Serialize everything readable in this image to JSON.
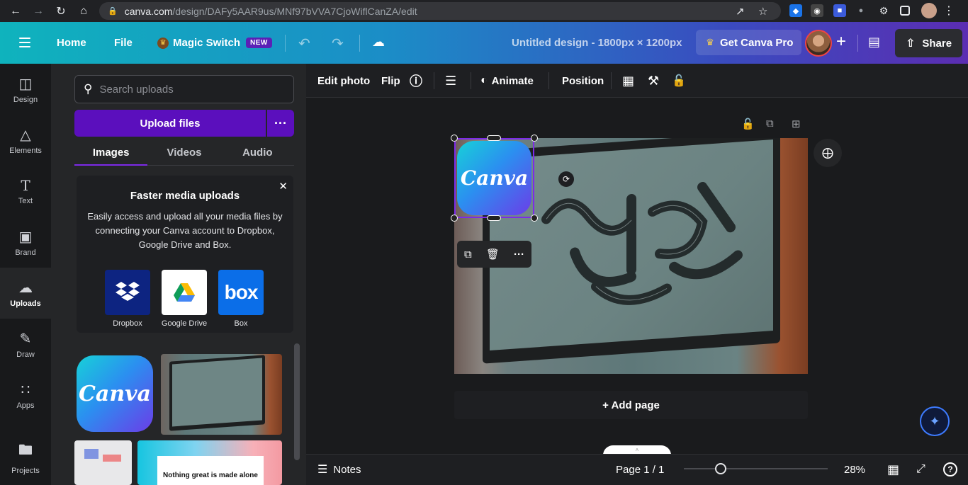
{
  "browser": {
    "url_host": "canva.com",
    "url_path": "/design/DAFy5AAR9us/MNf97bVVA7CjoWiflCanZA/edit"
  },
  "header": {
    "home": "Home",
    "file": "File",
    "magic_switch": "Magic Switch",
    "new_badge": "NEW",
    "design_title": "Untitled design - 1800px × 1200px",
    "get_pro": "Get Canva Pro",
    "share": "Share"
  },
  "rail": {
    "items": [
      {
        "label": "Design",
        "icon": "design-icon"
      },
      {
        "label": "Elements",
        "icon": "elements-icon"
      },
      {
        "label": "Text",
        "icon": "text-icon"
      },
      {
        "label": "Brand",
        "icon": "brand-icon"
      },
      {
        "label": "Uploads",
        "icon": "upload-icon"
      },
      {
        "label": "Draw",
        "icon": "draw-icon"
      },
      {
        "label": "Apps",
        "icon": "apps-icon"
      },
      {
        "label": "Projects",
        "icon": "folder-icon"
      }
    ]
  },
  "panel": {
    "search_placeholder": "Search uploads",
    "upload_button": "Upload files",
    "tabs": [
      "Images",
      "Videos",
      "Audio"
    ],
    "promo": {
      "title": "Faster media uploads",
      "body": "Easily access and upload all your media files by connecting your Canva account to Dropbox, Google Drive and Box.",
      "providers": [
        "Dropbox",
        "Google Drive",
        "Box"
      ]
    },
    "thumb_logo_text": "Canva",
    "thumb_site_text": "Nothing great is made alone"
  },
  "toolbar": {
    "edit_photo": "Edit photo",
    "flip": "Flip",
    "animate": "Animate",
    "position": "Position"
  },
  "canvas": {
    "logo_text": "Canva",
    "add_page": "+ Add page"
  },
  "footer": {
    "notes": "Notes",
    "page": "Page 1 / 1",
    "zoom": "28%"
  }
}
